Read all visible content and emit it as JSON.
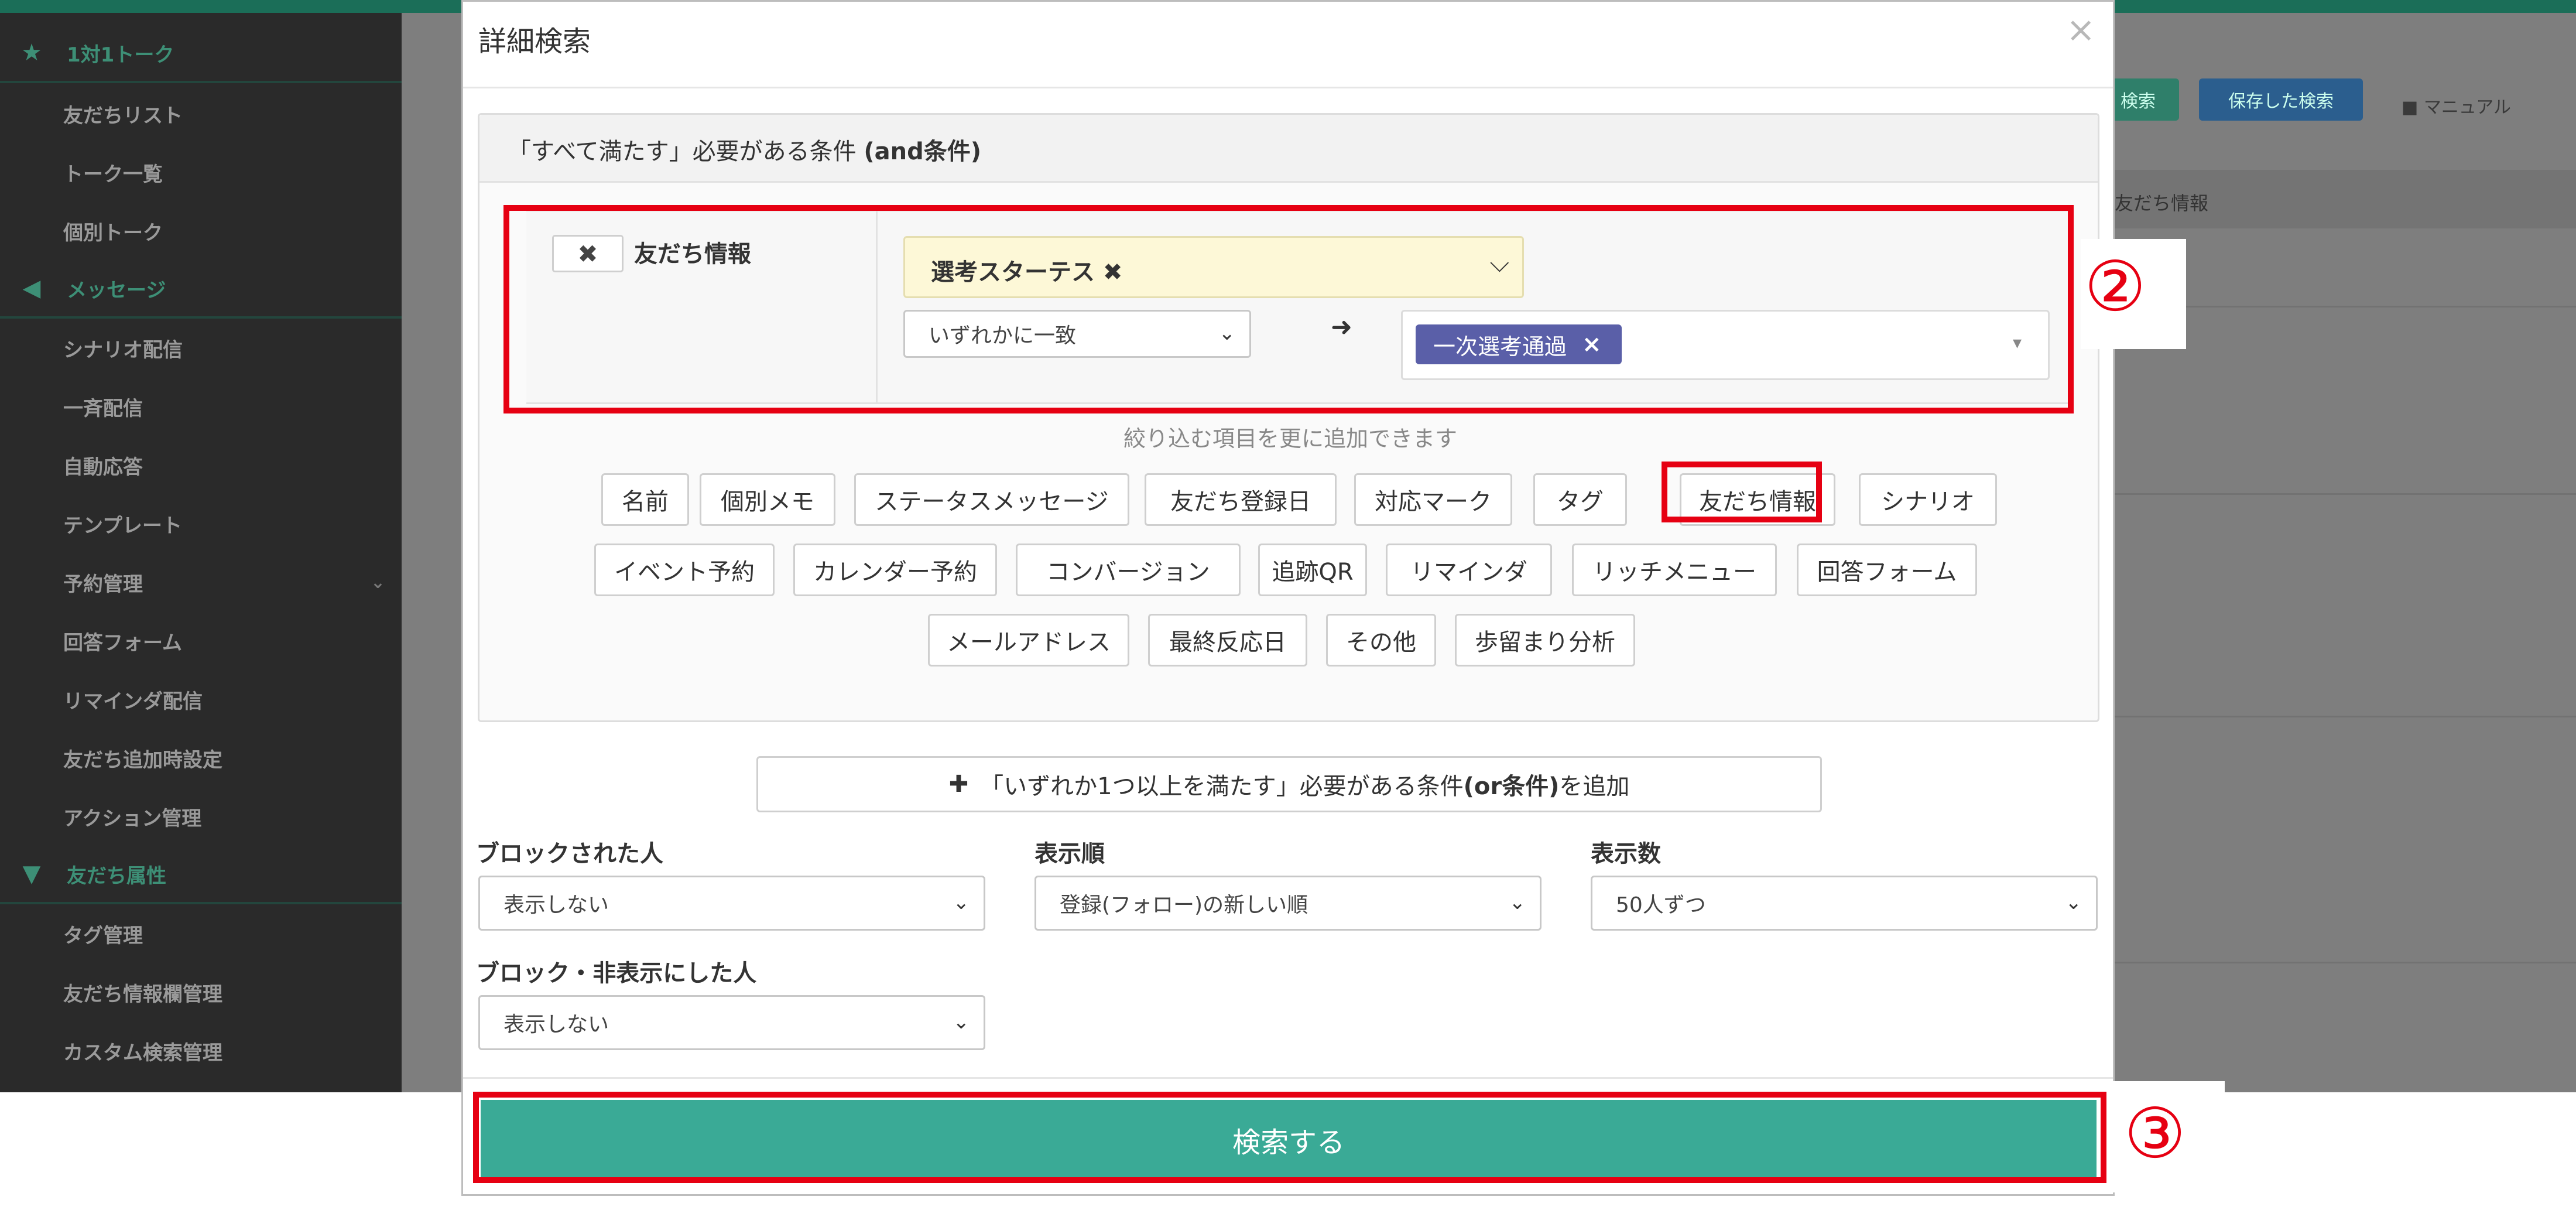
{
  "background": {
    "sidebar": [
      {
        "label": "1対1トーク",
        "group": true,
        "icon": "star-icon"
      },
      {
        "label": "友だちリスト"
      },
      {
        "label": "トーク一覧"
      },
      {
        "label": "個別トーク"
      },
      {
        "label": "メッセージ",
        "group": true,
        "icon": "megaphone-icon"
      },
      {
        "label": "シナリオ配信"
      },
      {
        "label": "一斉配信"
      },
      {
        "label": "自動応答"
      },
      {
        "label": "テンプレート"
      },
      {
        "label": "予約管理"
      },
      {
        "label": "回答フォーム"
      },
      {
        "label": "リマインダ配信"
      },
      {
        "label": "友だち追加時設定"
      },
      {
        "label": "アクション管理"
      },
      {
        "label": "友だち属性",
        "group": true,
        "icon": "filter-icon"
      },
      {
        "label": "タグ管理"
      },
      {
        "label": "友だち情報欄管理"
      },
      {
        "label": "カスタム検索管理"
      }
    ],
    "toolbar": {
      "saved_search_label": "保存した検索",
      "manual_label": "マニュアル",
      "column_label": "友だち情報"
    }
  },
  "modal": {
    "title": "詳細検索",
    "close_symbol": "×",
    "and_group": {
      "header_prefix": "「すべて満たす」必要がある条件",
      "header_bold": "(and条件)",
      "condition": {
        "remove_symbol": "✖",
        "label": "友だち情報",
        "field_value": "選考スターテス ✖",
        "match_value": "いずれかに一致",
        "arrow": "➜",
        "selected_tag": "一次選考通過",
        "tag_remove": "×"
      },
      "hint": "絞り込む項目を更に追加できます",
      "filter_chips": [
        [
          "名前",
          "個別メモ",
          "ステータスメッセージ",
          "友だち登録日",
          "対応マーク",
          "タグ",
          "友だち情報",
          "シナリオ"
        ],
        [
          "イベント予約",
          "カレンダー予約",
          "コンバージョン",
          "追跡QR",
          "リマインダ",
          "リッチメニュー",
          "回答フォーム"
        ],
        [
          "メールアドレス",
          "最終反応日",
          "その他",
          "歩留まり分析"
        ]
      ]
    },
    "or_button": {
      "plus": "✚",
      "prefix": "「いずれか1つ以上を満たす」必要がある条件",
      "bold": "(or条件)",
      "suffix": "を追加"
    },
    "filters": {
      "blocked_label": "ブロックされた人",
      "blocked_value": "表示しない",
      "order_label": "表示順",
      "order_value": "登録(フォロー)の新しい順",
      "count_label": "表示数",
      "count_value": "50人ずつ",
      "hidden_label": "ブロック・非表示にした人",
      "hidden_value": "表示しない"
    },
    "search_button": "検索する"
  },
  "annotations": {
    "step2": "②",
    "step3": "③"
  },
  "colors": {
    "accent_green": "#3aaa96",
    "annotation_red": "#e60012",
    "tag_purple": "#5a5fa8",
    "field_yellow": "#fdf8d7"
  }
}
